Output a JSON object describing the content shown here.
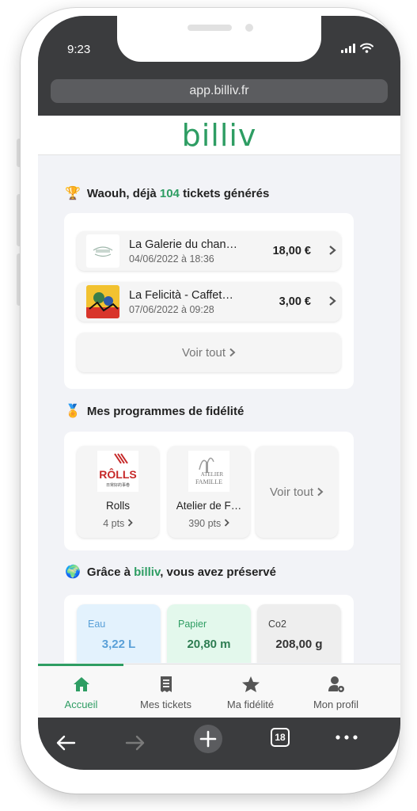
{
  "status_bar": {
    "time": "9:23",
    "icons": [
      "signal-icon",
      "wifi-icon"
    ]
  },
  "browser": {
    "url": "app.billiv.fr",
    "tab_count": "18"
  },
  "app": {
    "logo": "billiv",
    "brand_color": "#2e9d63"
  },
  "tickets_section": {
    "title_prefix": "Waouh, déjà",
    "count": "104",
    "title_suffix": "tickets générés",
    "items": [
      {
        "name": "La Galerie du chan…",
        "date": "04/06/2022 à 18:36",
        "amount": "18,00 €"
      },
      {
        "name": "La Felicità - Caffet…",
        "date": "07/06/2022 à 09:28",
        "amount": "3,00 €"
      }
    ],
    "see_all": "Voir tout"
  },
  "loyalty_section": {
    "title": "Mes programmes de fidélité",
    "programs": [
      {
        "name": "Rolls",
        "points": "4 pts",
        "logo_text": "RÔLLS",
        "logo_sub": "日常好的事卷"
      },
      {
        "name": "Atelier de F…",
        "points": "390 pts",
        "logo_text": "ATELIER",
        "logo_sub": "FAMILLE"
      }
    ],
    "see_all": "Voir tout"
  },
  "eco_section": {
    "title_prefix": "Grâce à",
    "brand": "billiv",
    "title_suffix": ", vous avez préservé",
    "items": [
      {
        "label": "Eau",
        "value": "3,22 L",
        "icon": "water-drops-icon",
        "bg": "#e3f2fd",
        "color": "#5aa0d8"
      },
      {
        "label": "Papier",
        "value": "20,80 m",
        "icon": "trees-icon",
        "bg": "#e3f8ec",
        "color": "#2e9d63"
      },
      {
        "label": "Co2",
        "value": "208,00 g",
        "icon": "cloud-icon",
        "bg": "#eeeeee",
        "color": "#444444"
      }
    ]
  },
  "bottom_nav": {
    "items": [
      {
        "label": "Accueil",
        "icon": "home-icon",
        "active": true
      },
      {
        "label": "Mes tickets",
        "icon": "receipt-icon",
        "active": false
      },
      {
        "label": "Ma fidélité",
        "icon": "star-icon",
        "active": false
      },
      {
        "label": "Mon profil",
        "icon": "user-gear-icon",
        "active": false
      }
    ]
  }
}
